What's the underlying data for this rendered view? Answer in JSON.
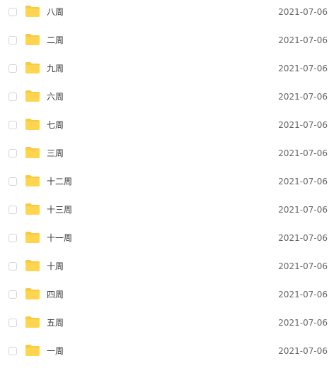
{
  "file_list": {
    "items": [
      {
        "name": "八周",
        "date": "2021-07-06",
        "icon": "folder-icon"
      },
      {
        "name": "二周",
        "date": "2021-07-06",
        "icon": "folder-icon"
      },
      {
        "name": "九周",
        "date": "2021-07-06",
        "icon": "folder-icon"
      },
      {
        "name": "六周",
        "date": "2021-07-06",
        "icon": "folder-icon"
      },
      {
        "name": "七周",
        "date": "2021-07-06",
        "icon": "folder-icon"
      },
      {
        "name": "三周",
        "date": "2021-07-06",
        "icon": "folder-icon"
      },
      {
        "name": "十二周",
        "date": "2021-07-06",
        "icon": "folder-icon"
      },
      {
        "name": "十三周",
        "date": "2021-07-06",
        "icon": "folder-icon"
      },
      {
        "name": "十一周",
        "date": "2021-07-06",
        "icon": "folder-icon"
      },
      {
        "name": "十周",
        "date": "2021-07-06",
        "icon": "folder-icon"
      },
      {
        "name": "四周",
        "date": "2021-07-06",
        "icon": "folder-icon"
      },
      {
        "name": "五周",
        "date": "2021-07-06",
        "icon": "folder-icon"
      },
      {
        "name": "一周",
        "date": "2021-07-06",
        "icon": "folder-icon"
      }
    ]
  },
  "colors": {
    "folder": "#FFD54F",
    "folder_tab": "#F9C93E",
    "checkbox_border": "#D2D6DC",
    "name_text": "#333333",
    "date_text": "#666666"
  }
}
